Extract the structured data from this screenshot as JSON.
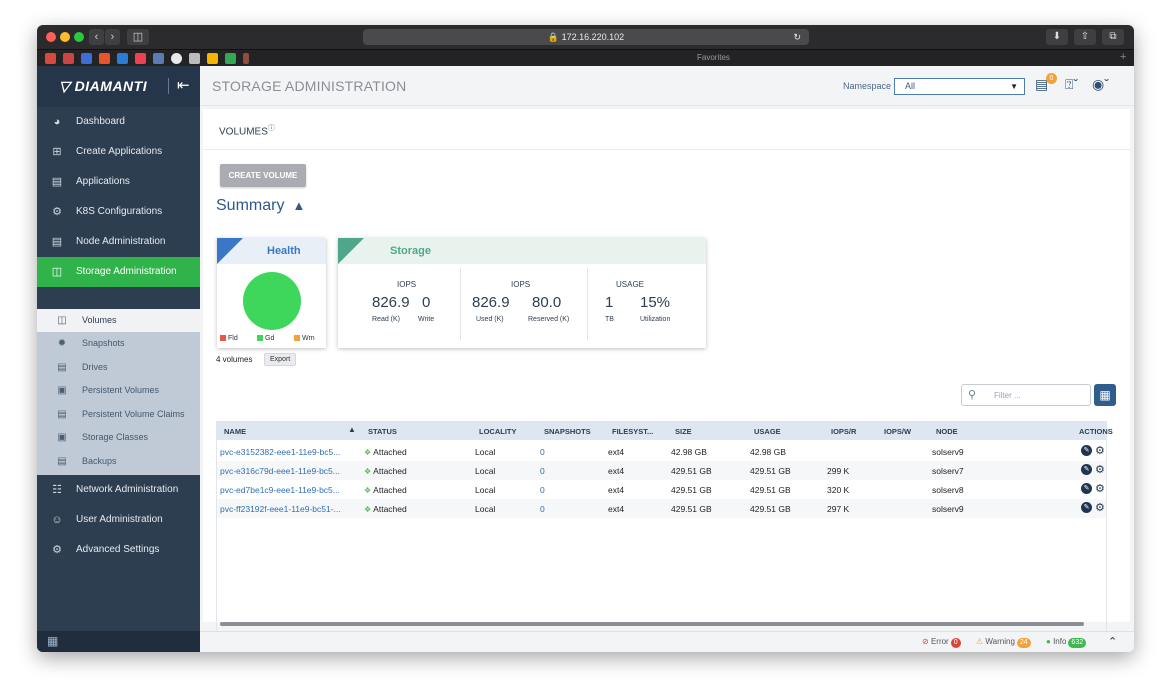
{
  "browser": {
    "url": "172.16.220.102",
    "favorites_label": "Favorites"
  },
  "sidebar": {
    "brand": "DIAMANTI",
    "items": [
      {
        "label": "Dashboard"
      },
      {
        "label": "Create Applications"
      },
      {
        "label": "Applications"
      },
      {
        "label": "K8S Configurations"
      },
      {
        "label": "Node Administration"
      },
      {
        "label": "Storage Administration"
      },
      {
        "label": "Network Administration"
      },
      {
        "label": "User Administration"
      },
      {
        "label": "Advanced Settings"
      }
    ],
    "subitems": [
      {
        "label": "Volumes"
      },
      {
        "label": "Snapshots"
      },
      {
        "label": "Drives"
      },
      {
        "label": "Persistent Volumes"
      },
      {
        "label": "Persistent Volume Claims"
      },
      {
        "label": "Storage Classes"
      },
      {
        "label": "Backups"
      }
    ]
  },
  "header": {
    "title": "STORAGE ADMINISTRATION",
    "namespace_label": "Namespace",
    "namespace_value": "All",
    "notification_count": "0"
  },
  "content": {
    "section": "VOLUMES",
    "create_button": "CREATE VOLUME",
    "summary_label": "Summary",
    "health": {
      "title": "Health",
      "legend": [
        "Fld",
        "Gd",
        "Wrn"
      ]
    },
    "storage": {
      "title": "Storage",
      "groups": [
        {
          "label": "IOPS",
          "values": [
            {
              "v": "826.9",
              "sub": "Read (K)"
            },
            {
              "v": "0",
              "sub": "Write"
            }
          ]
        },
        {
          "label": "IOPS",
          "values": [
            {
              "v": "826.9",
              "sub": "Used (K)"
            },
            {
              "v": "80.0",
              "sub": "Reserved (K)"
            }
          ]
        },
        {
          "label": "USAGE",
          "values": [
            {
              "v": "1",
              "sub": "TB"
            },
            {
              "v": "15%",
              "sub": "Utilization"
            }
          ]
        }
      ]
    },
    "volume_count": "4 volumes",
    "export_label": "Export",
    "filter_placeholder": "Filter ..."
  },
  "table": {
    "columns": [
      "NAME",
      "STATUS",
      "LOCALITY",
      "SNAPSHOTS",
      "FILESYST...",
      "SIZE",
      "USAGE",
      "IOPS/R",
      "IOPS/W",
      "NODE",
      "ACTIONS"
    ],
    "rows": [
      {
        "name": "pvc-e3152382-eee1-11e9-bc5...",
        "status": "Attached",
        "locality": "Local",
        "snapshots": "0",
        "fs": "ext4",
        "size": "42.98 GB",
        "usage": "42.98 GB",
        "iops_r": "",
        "iops_w": "",
        "node": "solserv9"
      },
      {
        "name": "pvc-e316c79d-eee1-11e9-bc5...",
        "status": "Attached",
        "locality": "Local",
        "snapshots": "0",
        "fs": "ext4",
        "size": "429.51 GB",
        "usage": "429.51 GB",
        "iops_r": "299 K",
        "iops_w": "",
        "node": "solserv7"
      },
      {
        "name": "pvc-ed7be1c9-eee1-11e9-bc5...",
        "status": "Attached",
        "locality": "Local",
        "snapshots": "0",
        "fs": "ext4",
        "size": "429.51 GB",
        "usage": "429.51 GB",
        "iops_r": "320 K",
        "iops_w": "",
        "node": "solserv8"
      },
      {
        "name": "pvc-ff23192f-eee1-11e9-bc51-...",
        "status": "Attached",
        "locality": "Local",
        "snapshots": "0",
        "fs": "ext4",
        "size": "429.51 GB",
        "usage": "429.51 GB",
        "iops_r": "297 K",
        "iops_w": "",
        "node": "solserv9"
      }
    ]
  },
  "statusbar": {
    "error_label": "Error",
    "error_count": "0",
    "warning_label": "Warning",
    "warning_count": "24",
    "info_label": "Info",
    "info_count": "632"
  },
  "colors": {
    "sidebar": "#2d3e50",
    "active": "#2fb34a",
    "accent": "#2f5d8c",
    "health_ok": "#3fd65c"
  }
}
